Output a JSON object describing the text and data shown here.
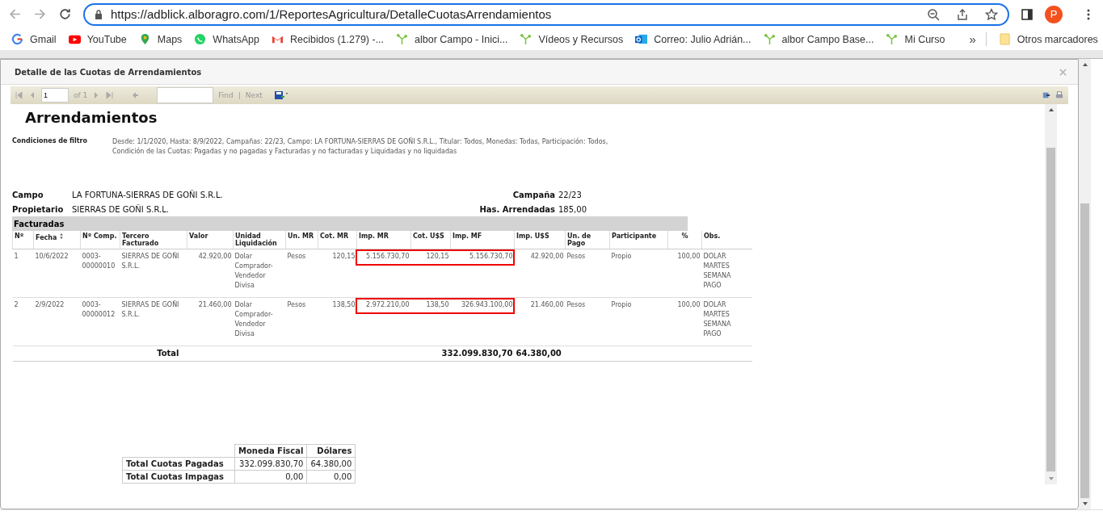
{
  "browser": {
    "url": "https://adblick.alboragro.com/1/ReportesAgricultura/DetalleCuotasArrendamientos",
    "profile_initial": "P",
    "bookmarks": [
      {
        "kind": "google",
        "label": "Gmail"
      },
      {
        "kind": "youtube",
        "label": "YouTube"
      },
      {
        "kind": "maps",
        "label": "Maps"
      },
      {
        "kind": "whatsapp",
        "label": "WhatsApp"
      },
      {
        "kind": "gmail",
        "label": "Recibidos (1.279) -..."
      },
      {
        "kind": "sprout",
        "label": "albor Campo - Inici..."
      },
      {
        "kind": "sprout",
        "label": "Vídeos y Recursos"
      },
      {
        "kind": "outlook",
        "label": "Correo: Julio Adrián..."
      },
      {
        "kind": "sprout",
        "label": "albor Campo Base..."
      },
      {
        "kind": "sprout",
        "label": "Mi Curso"
      }
    ],
    "more": "»",
    "other_bookmarks": "Otros marcadores"
  },
  "modal": {
    "title": "Detalle de las Cuotas de Arrendamientos",
    "toolbar": {
      "page": "1",
      "of": "of 1",
      "find": "Find",
      "separator": "|",
      "next": "Next"
    },
    "report": {
      "title": "Arrendamientos",
      "filter_label": "Condiciones de filtro",
      "filter_text": "Desde: 1/1/2020, Hasta: 8/9/2022, Campañas: 22/23, Campo: LA FORTUNA-SIERRAS DE GOÑI S.R.L., Titular: Todos, Monedas: Todas, Participación: Todos, Condición de las Cuotas: Pagadas y no pagadas y Facturadas y no facturadas y Liquidadas y no liquidadas",
      "fields_left": [
        {
          "label": "Campo",
          "value": "LA FORTUNA-SIERRAS DE GOÑI S.R.L."
        },
        {
          "label": "Propietario",
          "value": "SIERRAS DE GOÑI S.R.L."
        }
      ],
      "fields_right": [
        {
          "label": "Campaña",
          "value": "22/23"
        },
        {
          "label": "Has. Arrendadas",
          "value": "185,00"
        }
      ],
      "section": "Facturadas",
      "columns": [
        {
          "label": "Nº",
          "sortable": false
        },
        {
          "label": "Fecha",
          "sortable": true
        },
        {
          "label": "Nº Comp.",
          "sortable": false
        },
        {
          "label": "Tercero Facturado",
          "sortable": false
        },
        {
          "label": "Valor",
          "sortable": false
        },
        {
          "label": "Unidad Liquidación",
          "sortable": false
        },
        {
          "label": "Un. MR",
          "sortable": false
        },
        {
          "label": "Cot. MR",
          "sortable": false
        },
        {
          "label": "Imp. MR",
          "sortable": false
        },
        {
          "label": "Cot. U$S",
          "sortable": false
        },
        {
          "label": "Imp. MF",
          "sortable": false
        },
        {
          "label": "Imp. U$S",
          "sortable": false
        },
        {
          "label": "Un. de Pago",
          "sortable": false
        },
        {
          "label": "Participante",
          "sortable": false
        },
        {
          "label": "%",
          "sortable": false
        },
        {
          "label": "Obs.",
          "sortable": false
        }
      ],
      "rows": [
        {
          "highlighted": true,
          "cells": [
            "1",
            "10/6/2022",
            "0003-00000010",
            "SIERRAS DE GOÑI S.R.L.",
            "42.920,00",
            "Dolar Comprador-Vendedor Divisa",
            "Pesos",
            "120,15",
            "5.156.730,70",
            "120,15",
            "5.156.730,70",
            "42.920,00",
            "Pesos",
            "Propio",
            "100,00",
            "DOLAR MARTES SEMANA PAGO"
          ]
        },
        {
          "highlighted": true,
          "cells": [
            "2",
            "2/9/2022",
            "0003-00000012",
            "SIERRAS DE GOÑI S.R.L.",
            "21.460,00",
            "Dolar Comprador-Vendedor Divisa",
            "Pesos",
            "138,50",
            "2.972.210,00",
            "138,50",
            "326.943.100,00",
            "21.460,00",
            "Pesos",
            "Propio",
            "100,00",
            "DOLAR MARTES SEMANA PAGO"
          ]
        }
      ],
      "total_label": "Total",
      "total_mf": "332.099.830,70",
      "total_usd": "64.380,00",
      "summary": {
        "columns": [
          "Moneda Fiscal",
          "Dólares"
        ],
        "rows": [
          {
            "label": "Total Cuotas Pagadas",
            "values": [
              "332.099.830,70",
              "64.380,00"
            ]
          },
          {
            "label": "Total Cuotas Impagas",
            "values": [
              "0,00",
              "0,00"
            ]
          }
        ]
      }
    }
  }
}
